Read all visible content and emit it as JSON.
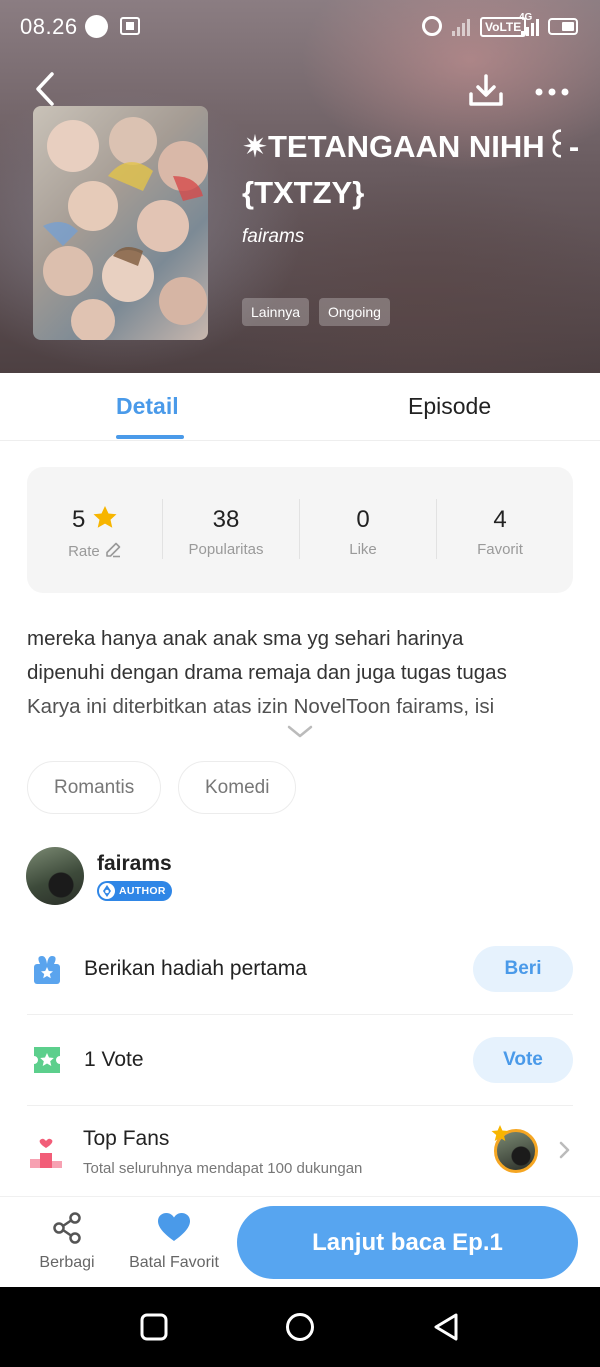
{
  "status_bar": {
    "time": "08.26",
    "network_label": "VoLTE",
    "network_gen": "4G"
  },
  "book": {
    "title": "✷TETANGAAN NIHH꒰-{TXTZY}",
    "author": "fairams",
    "tags": [
      "Lainnya",
      "Ongoing"
    ]
  },
  "tabs": [
    {
      "label": "Detail",
      "active": true
    },
    {
      "label": "Episode",
      "active": false
    }
  ],
  "stats": [
    {
      "value": "5",
      "label": "Rate"
    },
    {
      "value": "38",
      "label": "Popularitas"
    },
    {
      "value": "0",
      "label": "Like"
    },
    {
      "value": "4",
      "label": "Favorit"
    }
  ],
  "description": {
    "lines": [
      "mereka hanya anak anak sma yg sehari harinya",
      "dipenuhi dengan drama remaja dan  juga tugas tugas",
      "Karya ini diterbitkan atas izin NovelToon fairams, isi"
    ]
  },
  "genres": [
    "Romantis",
    "Komedi"
  ],
  "author_card": {
    "name": "fairams",
    "badge": "AUTHOR"
  },
  "gift_row": {
    "text": "Berikan hadiah pertama",
    "button": "Beri"
  },
  "vote_row": {
    "text": "1  Vote",
    "button": "Vote"
  },
  "fans_row": {
    "title": "Top Fans",
    "subtitle": "Total seluruhnya mendapat 100 dukungan"
  },
  "action_bar": {
    "share_label": "Berbagi",
    "favorite_label": "Batal Favorit",
    "read_label": "Lanjut baca Ep.1"
  },
  "colors": {
    "accent": "#4a9ae9",
    "read_button": "#57a5f0",
    "star": "#f7b500",
    "gift_icon": "#5aa4ee",
    "vote_icon": "#5ccf8c",
    "fans_icon": "#f25d78"
  }
}
